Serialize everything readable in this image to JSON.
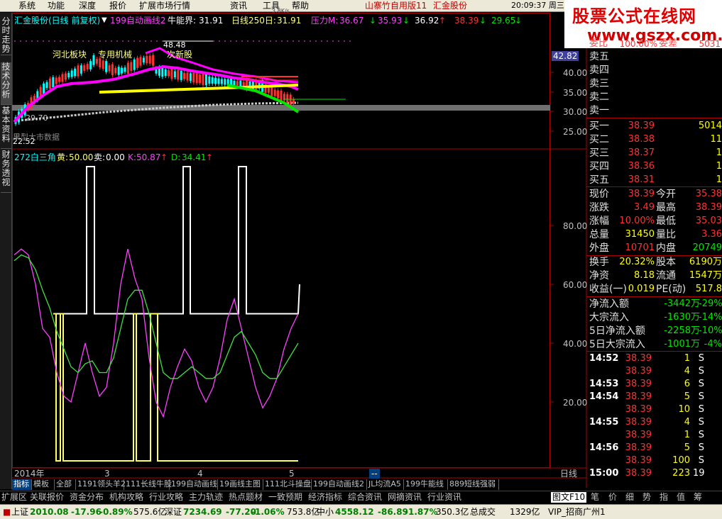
{
  "menu": [
    "系统",
    "功能",
    "深度",
    "报价",
    "扩展市场行情",
    "资讯",
    "工具",
    "帮助"
  ],
  "window_title": "山寨竹自用版11",
  "stock_title": "汇金股份",
  "clock": "20:09:37 周三",
  "speed": "3.8K/s",
  "watermark": {
    "line1": "股票公式在线网",
    "line2": "www.gszx.com.cn"
  },
  "left_tabs": [
    "分时走势",
    "技术分析",
    "基本资料",
    "财务透视"
  ],
  "top_header": {
    "name": "汇金股份(日线 前复权)",
    "indicator": "199自动画线2",
    "bull_label": "牛能界:",
    "bull_value": "31.91",
    "line_label": "日线250日:",
    "line_value": "31.91",
    "pressure_label": "压力M:",
    "pressure_value": "36.67",
    "v1": "35.93",
    "v2": "36.92",
    "v3": "38.39",
    "v4": "29.65"
  },
  "annotations": {
    "a1": "河北板块",
    "a2": "专用机械",
    "a3": "次新股",
    "high": "48.48",
    "low": "22.52",
    "left1": "29.70"
  },
  "missing_data": "果型大市数据",
  "price_axis": [
    "42.82",
    "40.00",
    "35.00",
    "30.00",
    "25.00"
  ],
  "lower_header": {
    "name": "272白三角",
    "yellow_label": "黄:",
    "yellow_value": "50.00",
    "sell_label": "卖:",
    "sell_value": "0.00",
    "k_label": "K:",
    "k_value": "50.87",
    "d_label": "D:",
    "d_value": "34.41"
  },
  "lower_axis": [
    "80.00",
    "60.00",
    "40.00",
    "20.00"
  ],
  "time_axis": {
    "year": "2014年",
    "m3": "3",
    "m4": "4",
    "m5": "5",
    "period": "日线"
  },
  "bottom_tabs": [
    "指标",
    "模板",
    "全部",
    "1191领头羊2",
    "111长线牛股",
    "199自动画线",
    "19画线主图",
    "111北斗操盘",
    "199自动画线2",
    "JL均流A5",
    "199牛能线",
    "889短线强弱"
  ],
  "func_tabs": [
    "扩展区",
    "关联报价",
    "资金分布",
    "机构攻略",
    "行业攻略",
    "主力轨迹",
    "热点题材",
    "一致预期",
    "经济指标",
    "综合资讯",
    "网摘资讯",
    "行业资讯"
  ],
  "func_right": [
    "图文F10",
    "笔",
    "价",
    "细",
    "势",
    "指",
    "值",
    "筹"
  ],
  "quote": {
    "ask": [
      {
        "label": "卖五",
        "price": "",
        "vol": ""
      },
      {
        "label": "卖四",
        "price": "",
        "vol": ""
      },
      {
        "label": "卖三",
        "price": "",
        "vol": ""
      },
      {
        "label": "卖二",
        "price": "",
        "vol": ""
      },
      {
        "label": "卖一",
        "price": "",
        "vol": ""
      }
    ],
    "bid": [
      {
        "label": "买一",
        "price": "38.39",
        "vol": "5014"
      },
      {
        "label": "买二",
        "price": "38.38",
        "vol": "11"
      },
      {
        "label": "买三",
        "price": "38.37",
        "vol": "1"
      },
      {
        "label": "买四",
        "price": "38.36",
        "vol": "1"
      },
      {
        "label": "买五",
        "price": "38.31",
        "vol": "1"
      }
    ],
    "stats": [
      {
        "l1": "现价",
        "v1": "38.39",
        "l2": "今开",
        "v2": "35.38"
      },
      {
        "l1": "涨跌",
        "v1": "3.49",
        "l2": "最高",
        "v2": "38.39"
      },
      {
        "l1": "涨幅",
        "v1": "10.00%",
        "l2": "最低",
        "v2": "35.03"
      },
      {
        "l1": "总量",
        "v1": "31450",
        "l2": "量比",
        "v2": "3.36"
      },
      {
        "l1": "外盘",
        "v1": "10701",
        "l2": "内盘",
        "v2": "20749"
      }
    ],
    "fund": [
      {
        "l1": "换手",
        "v1": "20.32%",
        "l2": "股本",
        "v2": "6190万"
      },
      {
        "l1": "净资",
        "v1": "8.18",
        "l2": "流通",
        "v2": "1547万"
      },
      {
        "l1": "收益(一)",
        "v1": "0.019",
        "l2": "PE(动)",
        "v2": "517.8"
      }
    ],
    "flows": [
      {
        "label": "净流入额",
        "value": "-3442万",
        "pct": "-29%"
      },
      {
        "label": "大宗流入",
        "value": "-1630万",
        "pct": "-14%"
      },
      {
        "label": "5日净流入额",
        "value": "-2258万",
        "pct": "-10%"
      },
      {
        "label": "5日大宗流入",
        "value": "-1001万",
        "pct": "-4%"
      }
    ],
    "ticks": [
      {
        "time": "14:52",
        "price": "38.39",
        "vol": "1",
        "bs": "S"
      },
      {
        "time": "",
        "price": "38.39",
        "vol": "4",
        "bs": "S"
      },
      {
        "time": "14:53",
        "price": "38.39",
        "vol": "6",
        "bs": "S"
      },
      {
        "time": "14:54",
        "price": "38.39",
        "vol": "5",
        "bs": "S"
      },
      {
        "time": "",
        "price": "38.39",
        "vol": "10",
        "bs": "S"
      },
      {
        "time": "14:55",
        "price": "38.39",
        "vol": "4",
        "bs": "S"
      },
      {
        "time": "",
        "price": "38.39",
        "vol": "1",
        "bs": "S"
      },
      {
        "time": "14:56",
        "price": "38.39",
        "vol": "5",
        "bs": "S"
      },
      {
        "time": "",
        "price": "38.39",
        "vol": "100",
        "bs": "S"
      },
      {
        "time": "15:00",
        "price": "38.39",
        "vol": "223",
        "bs": "19"
      }
    ],
    "top_partial": {
      "l1": "委比",
      "v1": "100.00%",
      "l2": "委差",
      "v2": "5031"
    }
  },
  "status": {
    "sh_label": "上证",
    "sh_val": "2010.08",
    "sh_chg": "-17.96",
    "sh_pct": "-0.89%",
    "sh_amt": "575.6亿",
    "sz_label": "深证",
    "sz_val": "7234.69",
    "sz_chg": "-77.20",
    "sz_pct": "-1.06%",
    "sz_amt": "753.8亿",
    "zx_label": "中小",
    "zx_val": "4558.12",
    "zx_chg": "-86.89",
    "zx_pct": "-1.87%",
    "zx_amt": "350.3亿",
    "total_label": "总成交",
    "total_val": "1329亿",
    "vip": "VIP_招商广州1"
  },
  "kdj_data": {
    "x": [
      0,
      1,
      2,
      3,
      4,
      5,
      6,
      7,
      8,
      9,
      10,
      11,
      12,
      13,
      14,
      15,
      16,
      17,
      18,
      19,
      20,
      21,
      22,
      23,
      24,
      25,
      26,
      27,
      28,
      29,
      30,
      31,
      32,
      33,
      34,
      35,
      36,
      37,
      38,
      39,
      40
    ],
    "k": [
      70,
      72,
      70,
      60,
      45,
      42,
      30,
      22,
      20,
      30,
      40,
      30,
      22,
      25,
      40,
      60,
      72,
      62,
      55,
      35,
      20,
      15,
      25,
      32,
      38,
      34,
      25,
      20,
      25,
      35,
      48,
      55,
      45,
      35,
      25,
      18,
      22,
      28,
      38,
      45,
      50
    ],
    "d": [
      68,
      70,
      69,
      65,
      58,
      52,
      44,
      38,
      32,
      30,
      33,
      34,
      30,
      30,
      35,
      45,
      55,
      58,
      58,
      50,
      40,
      30,
      28,
      28,
      30,
      32,
      30,
      28,
      28,
      30,
      36,
      42,
      44,
      40,
      36,
      30,
      28,
      28,
      32,
      36,
      40
    ]
  },
  "signal_data": {
    "white_spikes": [
      [
        122,
        133
      ],
      [
        258,
        268
      ],
      [
        336,
        347
      ]
    ],
    "yellow_spikes": [
      [
        79,
        89
      ],
      [
        188,
        207
      ],
      [
        212,
        222
      ]
    ]
  }
}
